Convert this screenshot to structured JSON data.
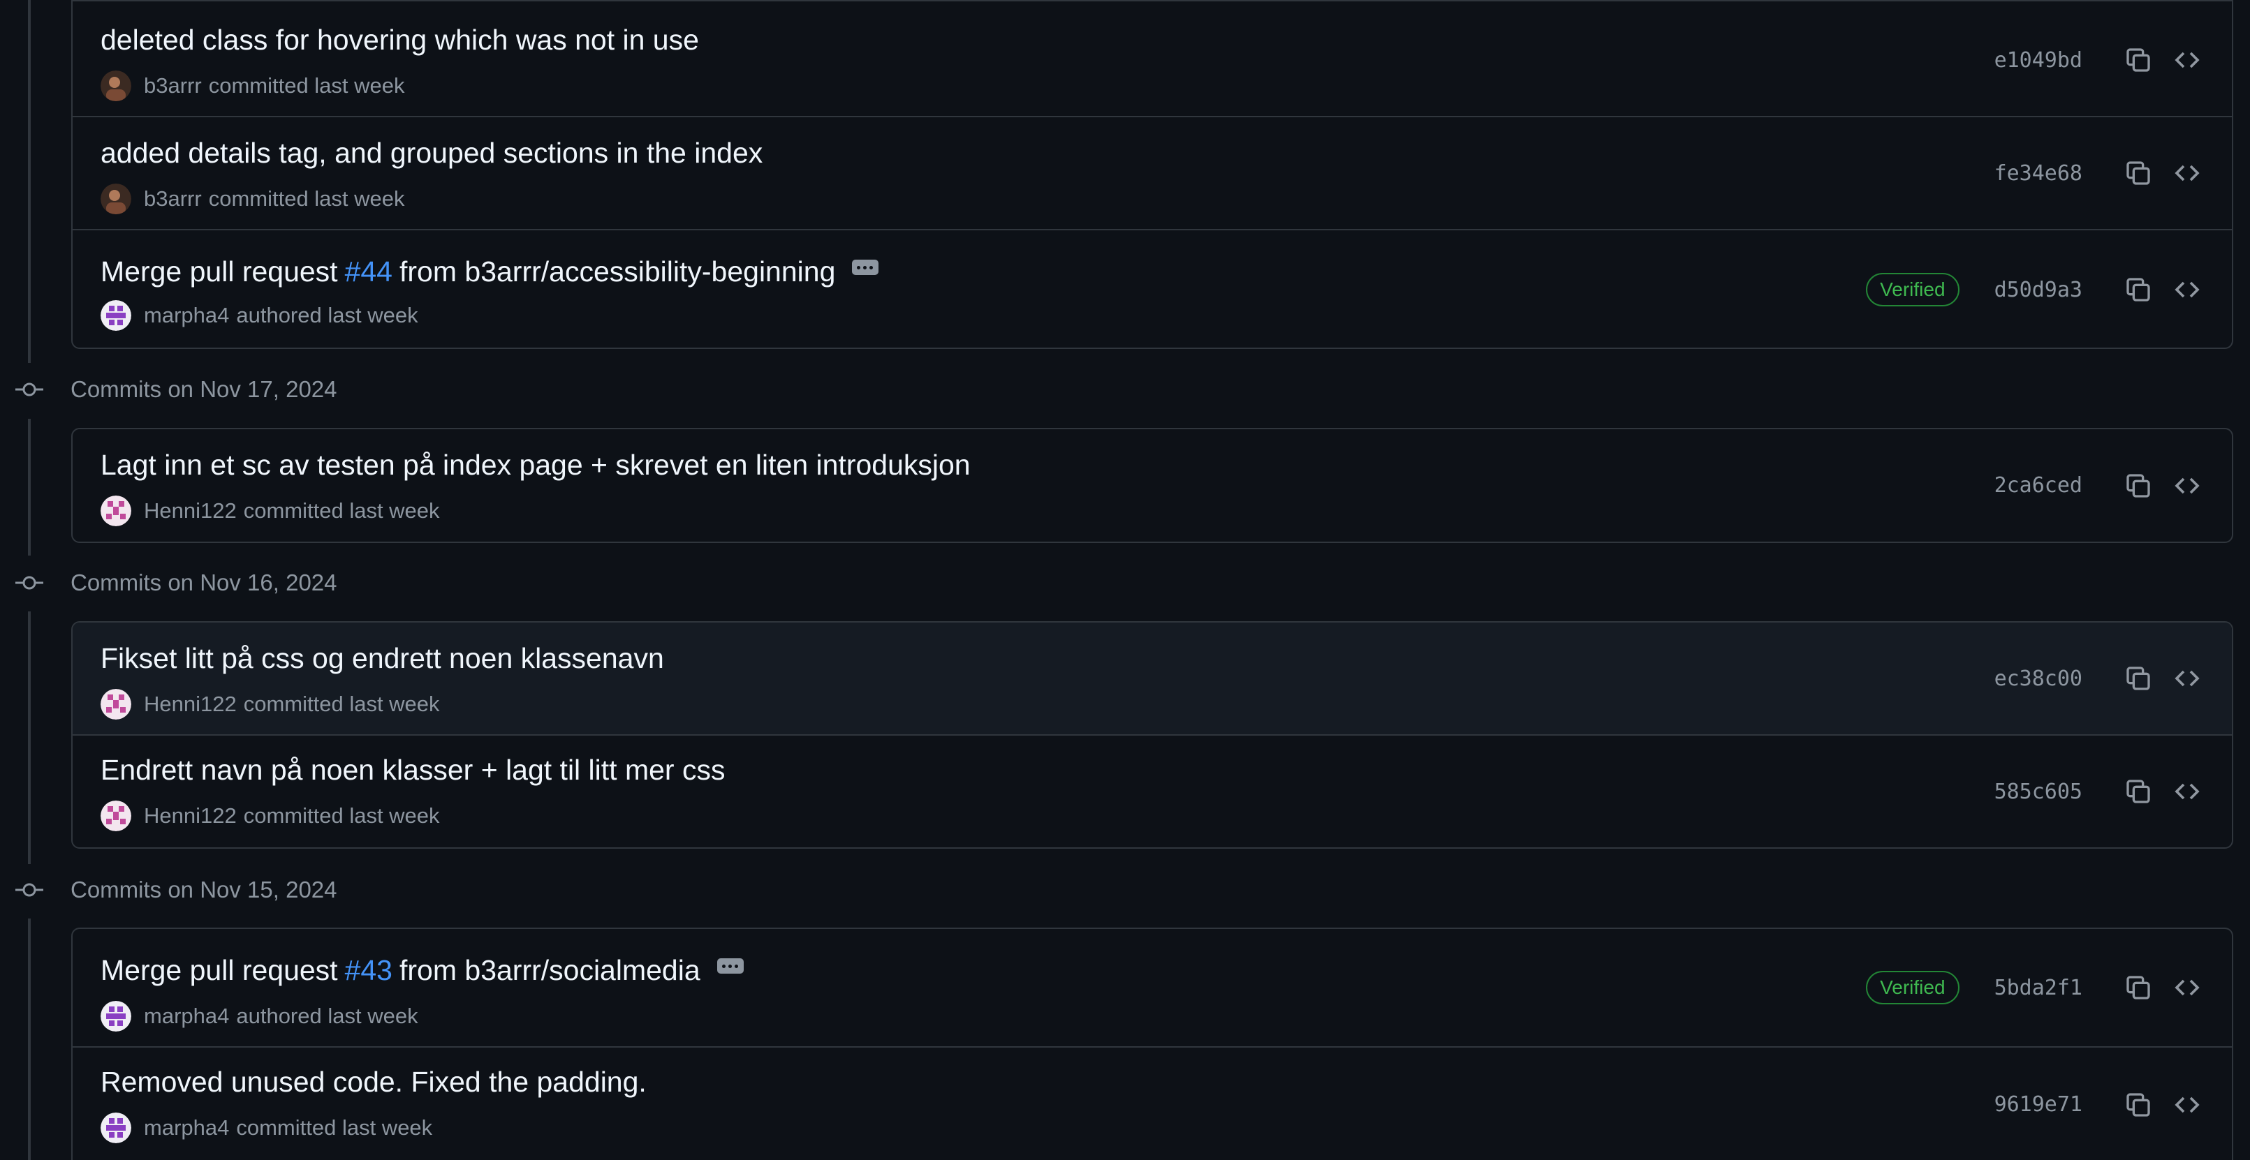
{
  "groups": [
    {
      "title": ""
    },
    {
      "title": "Commits on Nov 17, 2024"
    },
    {
      "title": "Commits on Nov 16, 2024"
    },
    {
      "title": "Commits on Nov 15, 2024"
    }
  ],
  "commits": [
    {
      "message": "deleted class for hovering which was not in use",
      "author": "b3arrr",
      "action": "committed last week",
      "sha": "e1049bd",
      "avatar": "photo"
    },
    {
      "message": "added details tag, and grouped sections in the index",
      "author": "b3arrr",
      "action": "committed last week",
      "sha": "fe34e68",
      "avatar": "photo"
    },
    {
      "message_prefix": "Merge pull request",
      "pr": "#44",
      "message_suffix": "from b3arrr/accessibility-beginning",
      "author": "marpha4",
      "action": "authored last week",
      "verified": "Verified",
      "sha": "d50d9a3",
      "avatar": "purple-identicon"
    },
    {
      "message": "Lagt inn et sc av testen på index page + skrevet en liten introduksjon",
      "author": "Henni122",
      "action": "committed last week",
      "sha": "2ca6ced",
      "avatar": "pink-identicon"
    },
    {
      "message": "Fikset litt på css og endrett noen klassenavn",
      "author": "Henni122",
      "action": "committed last week",
      "sha": "ec38c00",
      "avatar": "pink-identicon"
    },
    {
      "message": "Endrett navn på noen klasser + lagt til litt mer css",
      "author": "Henni122",
      "action": "committed last week",
      "sha": "585c605",
      "avatar": "pink-identicon"
    },
    {
      "message_prefix": "Merge pull request",
      "pr": "#43",
      "message_suffix": "from b3arrr/socialmedia",
      "author": "marpha4",
      "action": "authored last week",
      "verified": "Verified",
      "sha": "5bda2f1",
      "avatar": "purple-identicon"
    },
    {
      "message": "Removed unused code. Fixed the padding.",
      "author": "marpha4",
      "action": "committed last week",
      "sha": "9619e71",
      "avatar": "purple-identicon"
    }
  ],
  "colors": {
    "accent_link": "#4493f8",
    "verified": "#3fb950",
    "background": "#0d1117",
    "border": "#30363d"
  }
}
